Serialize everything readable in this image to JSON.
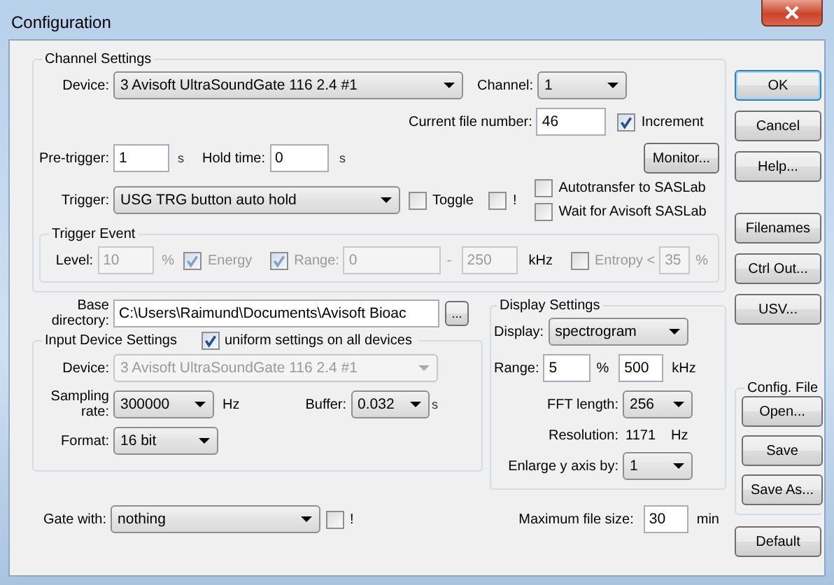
{
  "window": {
    "title": "Configuration"
  },
  "channel_settings": {
    "title": "Channel Settings",
    "device_label": "Device:",
    "device": "3 Avisoft UltraSoundGate 116 2.4 #1",
    "channel_label": "Channel:",
    "channel": "1",
    "file_number_label": "Current file number:",
    "file_number": "46",
    "increment": {
      "label": "Increment",
      "checked": true
    },
    "pretrigger_label": "Pre-trigger:",
    "pretrigger": "1",
    "pretrigger_unit": "s",
    "hold_label": "Hold time:",
    "hold": "0",
    "hold_unit": "s",
    "monitor_button": "Monitor...",
    "trigger_label": "Trigger:",
    "trigger": "USG TRG button auto hold",
    "toggle": {
      "label": "Toggle",
      "checked": false
    },
    "invert": {
      "label": "!",
      "checked": false
    },
    "autotransfer": {
      "label": "Autotransfer to SASLab",
      "checked": false
    },
    "wait": {
      "label": "Wait for Avisoft SASLab",
      "checked": false
    },
    "trigger_event": {
      "title": "Trigger Event",
      "disabled": true,
      "level_label": "Level:",
      "level_value": "10",
      "level_unit": "%",
      "energy": {
        "label": "Energy",
        "checked": true
      },
      "range": {
        "label": "Range:",
        "checked": true
      },
      "range_from": "0",
      "range_sep": "-",
      "range_to": "250",
      "range_unit": "kHz",
      "entropy": {
        "label": "Entropy <",
        "checked": false
      },
      "entropy_value": "35",
      "entropy_unit": "%"
    }
  },
  "base_directory": {
    "label": "Base directory:",
    "value": "C:\\Users\\Raimund\\Documents\\Avisoft Bioac",
    "browse": "..."
  },
  "input_device_settings": {
    "title": "Input Device Settings",
    "uniform": {
      "label": "uniform settings on all devices",
      "checked": true
    },
    "device_label": "Device:",
    "device": "3 Avisoft UltraSoundGate 116 2.4 #1",
    "device_disabled": true,
    "sampling_label": "Sampling rate:",
    "sampling": "300000",
    "sampling_unit": "Hz",
    "buffer_label": "Buffer:",
    "buffer": "0.032",
    "buffer_unit": "s",
    "format_label": "Format:",
    "format": "16 bit"
  },
  "display_settings": {
    "title": "Display Settings",
    "display_label": "Display:",
    "display": "spectrogram",
    "range_label": "Range:",
    "range_from": "5",
    "range_sep": "%",
    "range_to": "500",
    "range_unit": "kHz",
    "fft_label": "FFT length:",
    "fft": "256",
    "resolution_label": "Resolution:",
    "resolution": "1171",
    "resolution_unit": "Hz",
    "enlarge_label": "Enlarge y axis by:",
    "enlarge": "1"
  },
  "gate": {
    "label": "Gate with:",
    "value": "nothing",
    "invert": {
      "label": "!",
      "checked": false
    }
  },
  "max_file_size": {
    "label": "Maximum file size:",
    "value": "30",
    "unit": "min"
  },
  "buttons": [
    {
      "label": "OK",
      "default": true
    },
    {
      "label": "Cancel",
      "default": false
    },
    {
      "label": "Help...",
      "default": false
    },
    {
      "label": "Filenames",
      "default": false
    },
    {
      "label": "Ctrl Out...",
      "default": false
    },
    {
      "label": "USV...",
      "default": false
    }
  ],
  "config_file": {
    "title": "Config. File",
    "buttons": [
      "Open...",
      "Save",
      "Save As..."
    ]
  },
  "default_button": "Default"
}
